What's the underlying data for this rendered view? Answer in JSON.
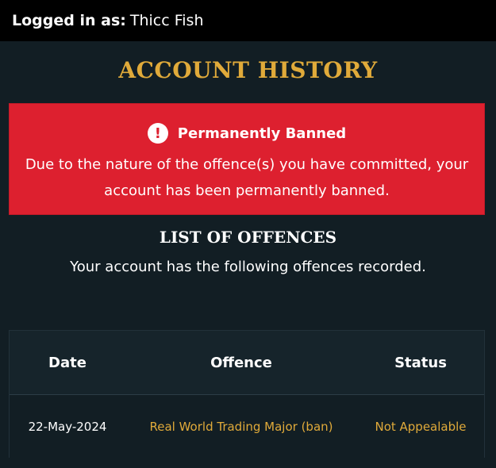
{
  "header": {
    "login_label": "Logged in as:",
    "username": "Thicc Fish"
  },
  "page": {
    "title": "ACCOUNT HISTORY"
  },
  "ban_notice": {
    "icon": "exclamation-circle-icon",
    "heading": "Permanently Banned",
    "message": "Due to the nature of the offence(s) you have committed, your account has been permanently banned.",
    "bg_color": "#dd202f"
  },
  "offences": {
    "title": "LIST OF OFFENCES",
    "subtitle": "Your account has the following offences recorded.",
    "columns": [
      "Date",
      "Offence",
      "Status"
    ],
    "rows": [
      {
        "date": "22-May-2024",
        "offence": "Real World Trading Major (ban)",
        "status": "Not Appealable"
      }
    ]
  },
  "colors": {
    "accent_gold": "#e0aa3a",
    "background": "#121e24",
    "topbar": "#000000"
  }
}
